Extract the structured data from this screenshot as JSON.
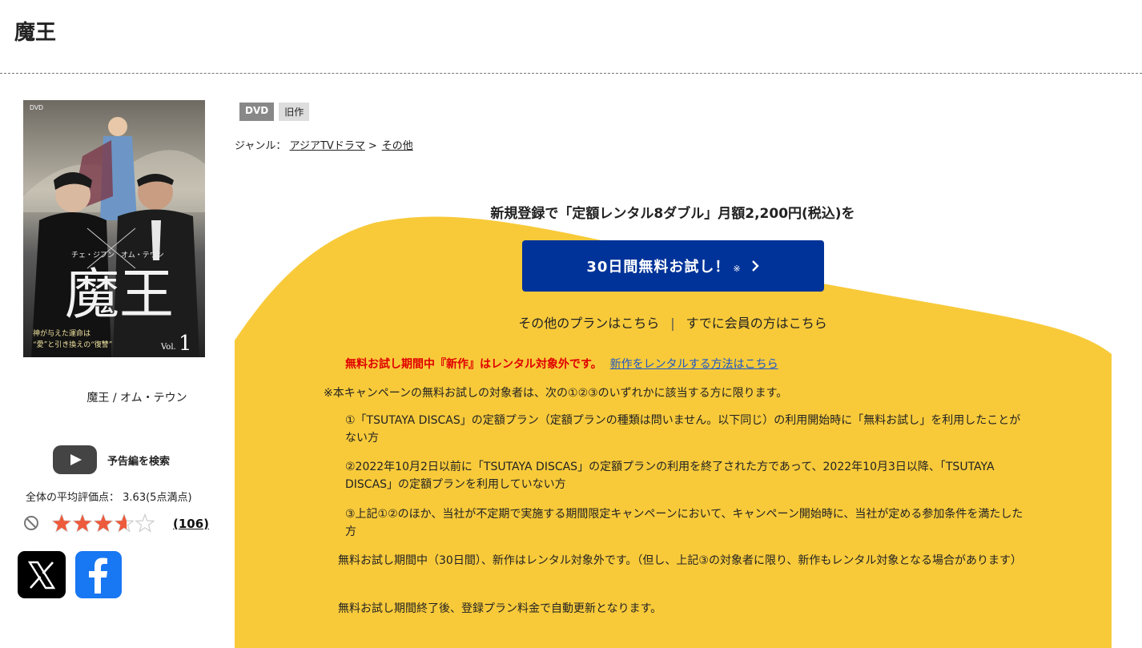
{
  "page": {
    "title": "魔王"
  },
  "product": {
    "jacket": {
      "cover_title": "魔王",
      "actor_1": "チェ・ジフン",
      "actor_2": "オム・テウン",
      "tagline_1": "神が与えた運命は",
      "tagline_2": "“愛”と引き換えの“復讐”",
      "vol_prefix": "Vol.",
      "vol_number": "1",
      "format_mark": "DVD"
    },
    "title_line": "魔王 / オム・テウン",
    "trailer_label": "予告編を検索",
    "avg_label": "全体の平均評価点：",
    "avg_value": "3.63(5点満点)",
    "rating": 3.63,
    "rating_max": 5,
    "review_count": "(106)",
    "icons": [
      "no-entry-icon",
      "play-icon",
      "x-logo-icon",
      "facebook-logo-icon",
      "chevron-right-icon",
      "star-icon"
    ]
  },
  "badges": {
    "format": "DVD",
    "age": "旧作"
  },
  "genre": {
    "label": "ジャンル：",
    "level1": "アジアTVドラマ",
    "separator": ">",
    "level2": "その他"
  },
  "promo": {
    "headline": "新規登録で「定額レンタル8ダブル」月額2,200円(税込)を",
    "cta_label": "30日間無料お試し！",
    "cta_mark": "※",
    "other_plans": "その他のプランはこちら",
    "plan_separator": "|",
    "members": "すでに会員の方はこちら",
    "warning": "無料お試し期間中『新作』はレンタル対象外です。",
    "warning_link": "新作をレンタルする方法はこちら",
    "note_intro": "※本キャンペーンの無料お試しの対象者は、次の①②③のいずれかに該当する方に限ります。",
    "conditions": [
      "①「TSUTAYA DISCAS」の定額プラン（定額プランの種類は問いません。以下同じ）の利用開始時に「無料お試し」を利用したことがない方",
      "②2022年10月2日以前に「TSUTAYA DISCAS」の定額プランの利用を終了された方であって、2022年10月3日以降、「TSUTAYA DISCAS」の定額プランを利用していない方",
      "③上記①②のほか、当社が不定期で実施する期間限定キャンペーンにおいて、キャンペーン開始時に、当社が定める参加条件を満たした方"
    ],
    "note_a": "無料お試し期間中（30日間）、新作はレンタル対象外です。（但し、上記③の対象者に限り、新作もレンタル対象となる場合があります）",
    "note_b": "無料お試し期間終了後、登録プラン料金で自動更新となります。"
  },
  "colors": {
    "promo_yellow": "#f8ca3a",
    "cta_blue": "#003399",
    "warning_red": "#e00000",
    "link_blue": "#1a56c8",
    "star_fill": "#ee5a3c",
    "star_empty": "#cccccc",
    "facebook_blue": "#1877f2"
  }
}
